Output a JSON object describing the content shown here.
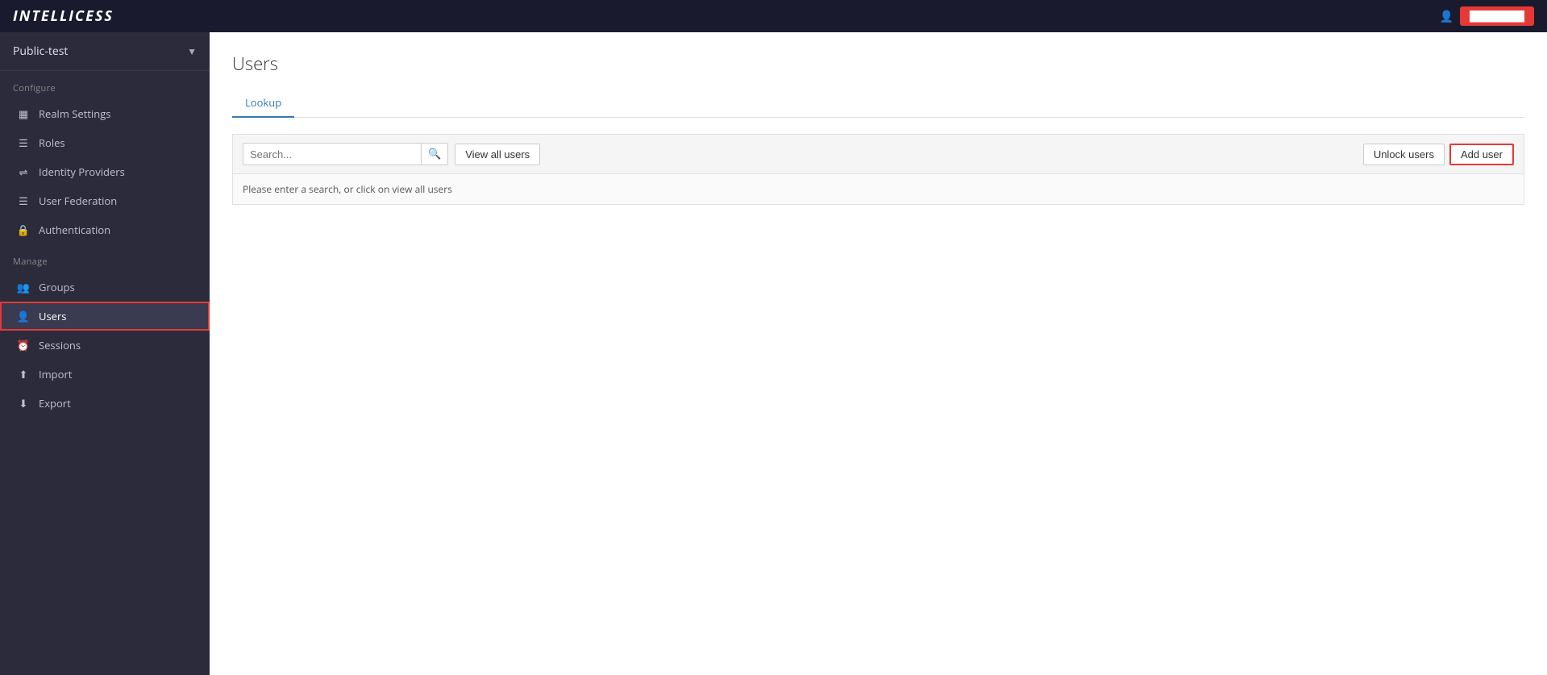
{
  "navbar": {
    "brand": "INTELLICESS",
    "user_btn_label": "████████"
  },
  "sidebar": {
    "realm": "Public-test",
    "configure_label": "Configure",
    "manage_label": "Manage",
    "configure_items": [
      {
        "id": "realm-settings",
        "label": "Realm Settings",
        "icon": "⊞"
      },
      {
        "id": "roles",
        "label": "Roles",
        "icon": "☰"
      },
      {
        "id": "identity-providers",
        "label": "Identity Providers",
        "icon": "⇆"
      },
      {
        "id": "user-federation",
        "label": "User Federation",
        "icon": "☰"
      },
      {
        "id": "authentication",
        "label": "Authentication",
        "icon": "🔒"
      }
    ],
    "manage_items": [
      {
        "id": "groups",
        "label": "Groups",
        "icon": "👥"
      },
      {
        "id": "users",
        "label": "Users",
        "icon": "👤",
        "active": true
      },
      {
        "id": "sessions",
        "label": "Sessions",
        "icon": "⏱"
      },
      {
        "id": "import",
        "label": "Import",
        "icon": "⬆"
      },
      {
        "id": "export",
        "label": "Export",
        "icon": "⬇"
      }
    ]
  },
  "main": {
    "page_title": "Users",
    "tabs": [
      {
        "id": "lookup",
        "label": "Lookup",
        "active": true
      }
    ],
    "search": {
      "placeholder": "Search...",
      "view_all_label": "View all users"
    },
    "buttons": {
      "unlock_users": "Unlock users",
      "add_user": "Add user"
    },
    "hint_text": "Please enter a search, or click on view all users"
  }
}
